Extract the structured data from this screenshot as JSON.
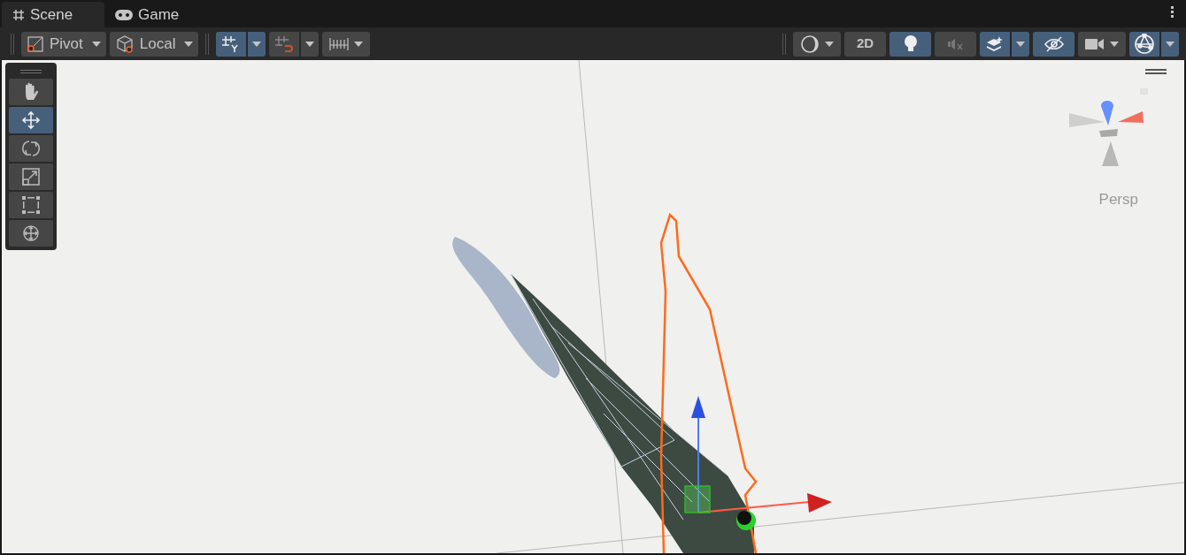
{
  "tabs": [
    {
      "label": "Scene",
      "selected": true
    },
    {
      "label": "Game",
      "selected": false
    }
  ],
  "toolbar_left": [
    {
      "kind": "dropdown",
      "label": "Pivot"
    },
    {
      "kind": "dropdown",
      "label": "Local"
    },
    {
      "kind": "split",
      "on": true
    },
    {
      "kind": "split",
      "on": false
    },
    {
      "kind": "menu",
      "on": false
    }
  ],
  "toolbar_right": [
    {
      "kind": "menu",
      "on": false
    },
    {
      "kind": "text",
      "label": "2D",
      "on": false
    },
    {
      "kind": "icon",
      "on": true
    },
    {
      "kind": "icon",
      "on": false
    },
    {
      "kind": "split",
      "on": true
    },
    {
      "kind": "icon",
      "on": true
    },
    {
      "kind": "menu",
      "on": false
    },
    {
      "kind": "split",
      "on": true
    }
  ],
  "tools": [
    {
      "selected": false
    },
    {
      "selected": true
    },
    {
      "selected": false
    },
    {
      "selected": false
    },
    {
      "selected": false
    },
    {
      "selected": false
    }
  ],
  "view_gizmo": {
    "label": "Persp"
  }
}
